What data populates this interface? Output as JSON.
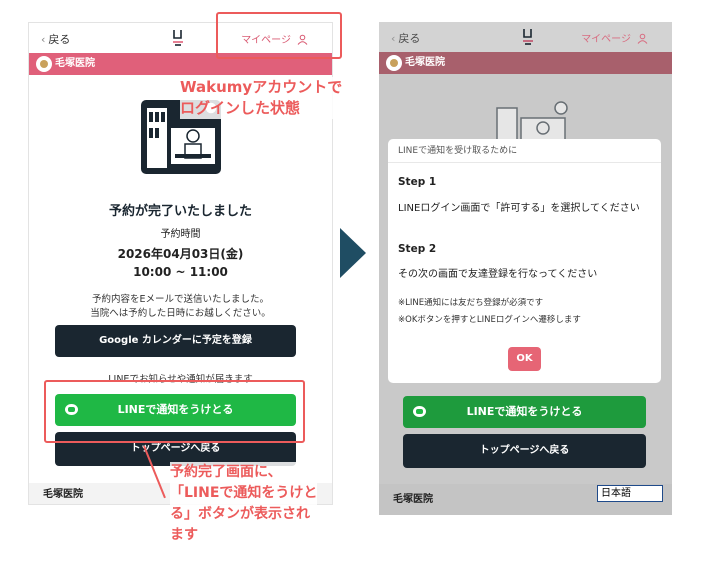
{
  "left": {
    "back_label": "戻る",
    "mypage_label": "マイページ",
    "clinic_name": "毛塚医院",
    "complete_title": "予約が完了いたしました",
    "time_label": "予約時間",
    "date": "2026年04月03日(金)",
    "time_range": "10:00 ~ 11:00",
    "message_line1": "予約内容をEメールで送信いたしました。",
    "message_line2": "当院へは予約した日時にお越しください。",
    "google_button": "Google カレンダーに予定を登録",
    "line_notice": "LINEでお知らせや通知が届きます",
    "line_button": "LINEで通知をうけとる",
    "top_button": "トップページへ戻る",
    "footer_clinic": "毛塚医院"
  },
  "annotations": {
    "login_line1": "Wakumyアカウントで",
    "login_line2": "ログインした状態",
    "result_line1": "予約完了画面に、",
    "result_line2": "「LINEで通知をうけと",
    "result_line3": "る」ボタンが表示され",
    "result_line4": "ます"
  },
  "right": {
    "back_label": "戻る",
    "mypage_label": "マイページ",
    "clinic_name": "毛塚医院",
    "modal": {
      "header": "LINEで通知を受け取るために",
      "step1_title": "Step 1",
      "step1_text": "LINEログイン画面で「許可する」を選択してください",
      "step2_title": "Step 2",
      "step2_text": "その次の画面で友達登録を行なってください",
      "note1": "※LINE通知には友だち登録が必須です",
      "note2": "※OKボタンを押すとLINEログインへ遷移します",
      "ok_label": "OK"
    },
    "line_button": "LINEで通知をうけとる",
    "top_button": "トップページへ戻る",
    "footer_clinic": "毛塚医院",
    "language": "日本語"
  },
  "colors": {
    "brand_pink": "#e0607a",
    "line_green": "#1fb845",
    "dark_button": "#1a2630",
    "annotation_red": "#ec5b5b",
    "arrow_navy": "#1f4d63"
  }
}
